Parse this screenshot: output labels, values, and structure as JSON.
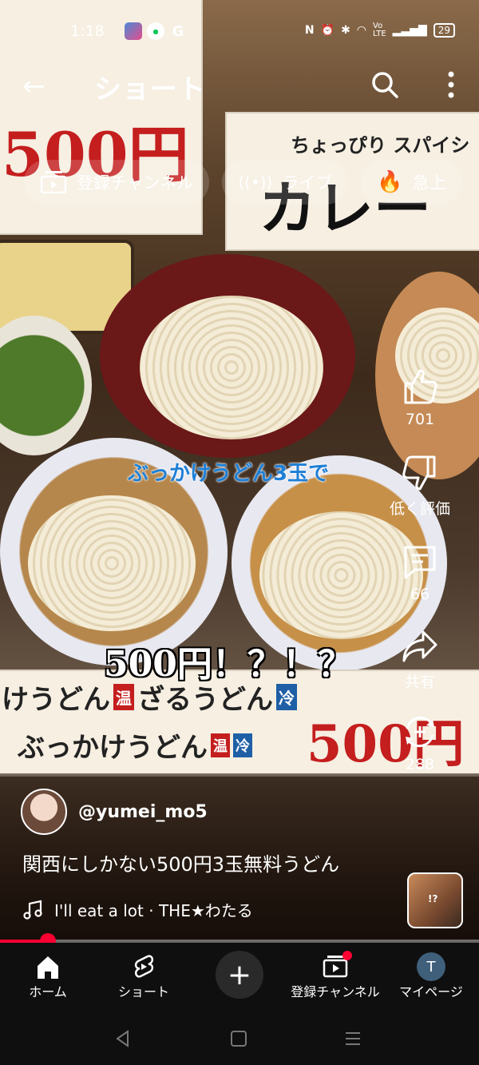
{
  "status_bar": {
    "time": "1:18",
    "apps": [
      "G"
    ],
    "battery": "29"
  },
  "header": {
    "title": "ショート"
  },
  "chips": [
    {
      "label": "登録チャンネル",
      "icon": "subscriptions-icon"
    },
    {
      "label": "ライブ",
      "icon": "live-icon"
    },
    {
      "label": "急上",
      "icon": "trending-icon"
    }
  ],
  "video": {
    "caption_top": "ぶっかけうどん3玉で",
    "caption_big": "500円！？！？",
    "sign_top_left": "500円",
    "sign_top_right_small": "ちょっぴり スパイシ",
    "sign_top_right_big": "カレー",
    "sign_bottom_line1": "けうどん",
    "sign_bottom_tag1": "温",
    "sign_bottom_line1b": "ざるうどん",
    "sign_bottom_tag2": "冷",
    "sign_bottom_line2": "ぶっかけうどん",
    "sign_bottom_tag3": "温",
    "sign_bottom_tag4": "冷",
    "sign_bottom_price": "500円",
    "progress": 0.1
  },
  "actions": {
    "like_count": "701",
    "dislike_label": "低く評価",
    "comment_count": "66",
    "share_label": "共有",
    "remix_count": "288"
  },
  "author": {
    "handle": "@yumei_mo5"
  },
  "description": "関西にしかない500円3玉無料うどん",
  "music": "I'll eat a lot · THE★わたる",
  "thumb_caption": "!?",
  "bottom_nav": {
    "home": "ホーム",
    "shorts": "ショート",
    "subscriptions": "登録チャンネル",
    "mypage": "マイページ",
    "avatar_letter": "T"
  },
  "colors": {
    "accent": "#ff0033",
    "caption_blue": "#1e7fd6",
    "price_red": "#c41e1e"
  }
}
